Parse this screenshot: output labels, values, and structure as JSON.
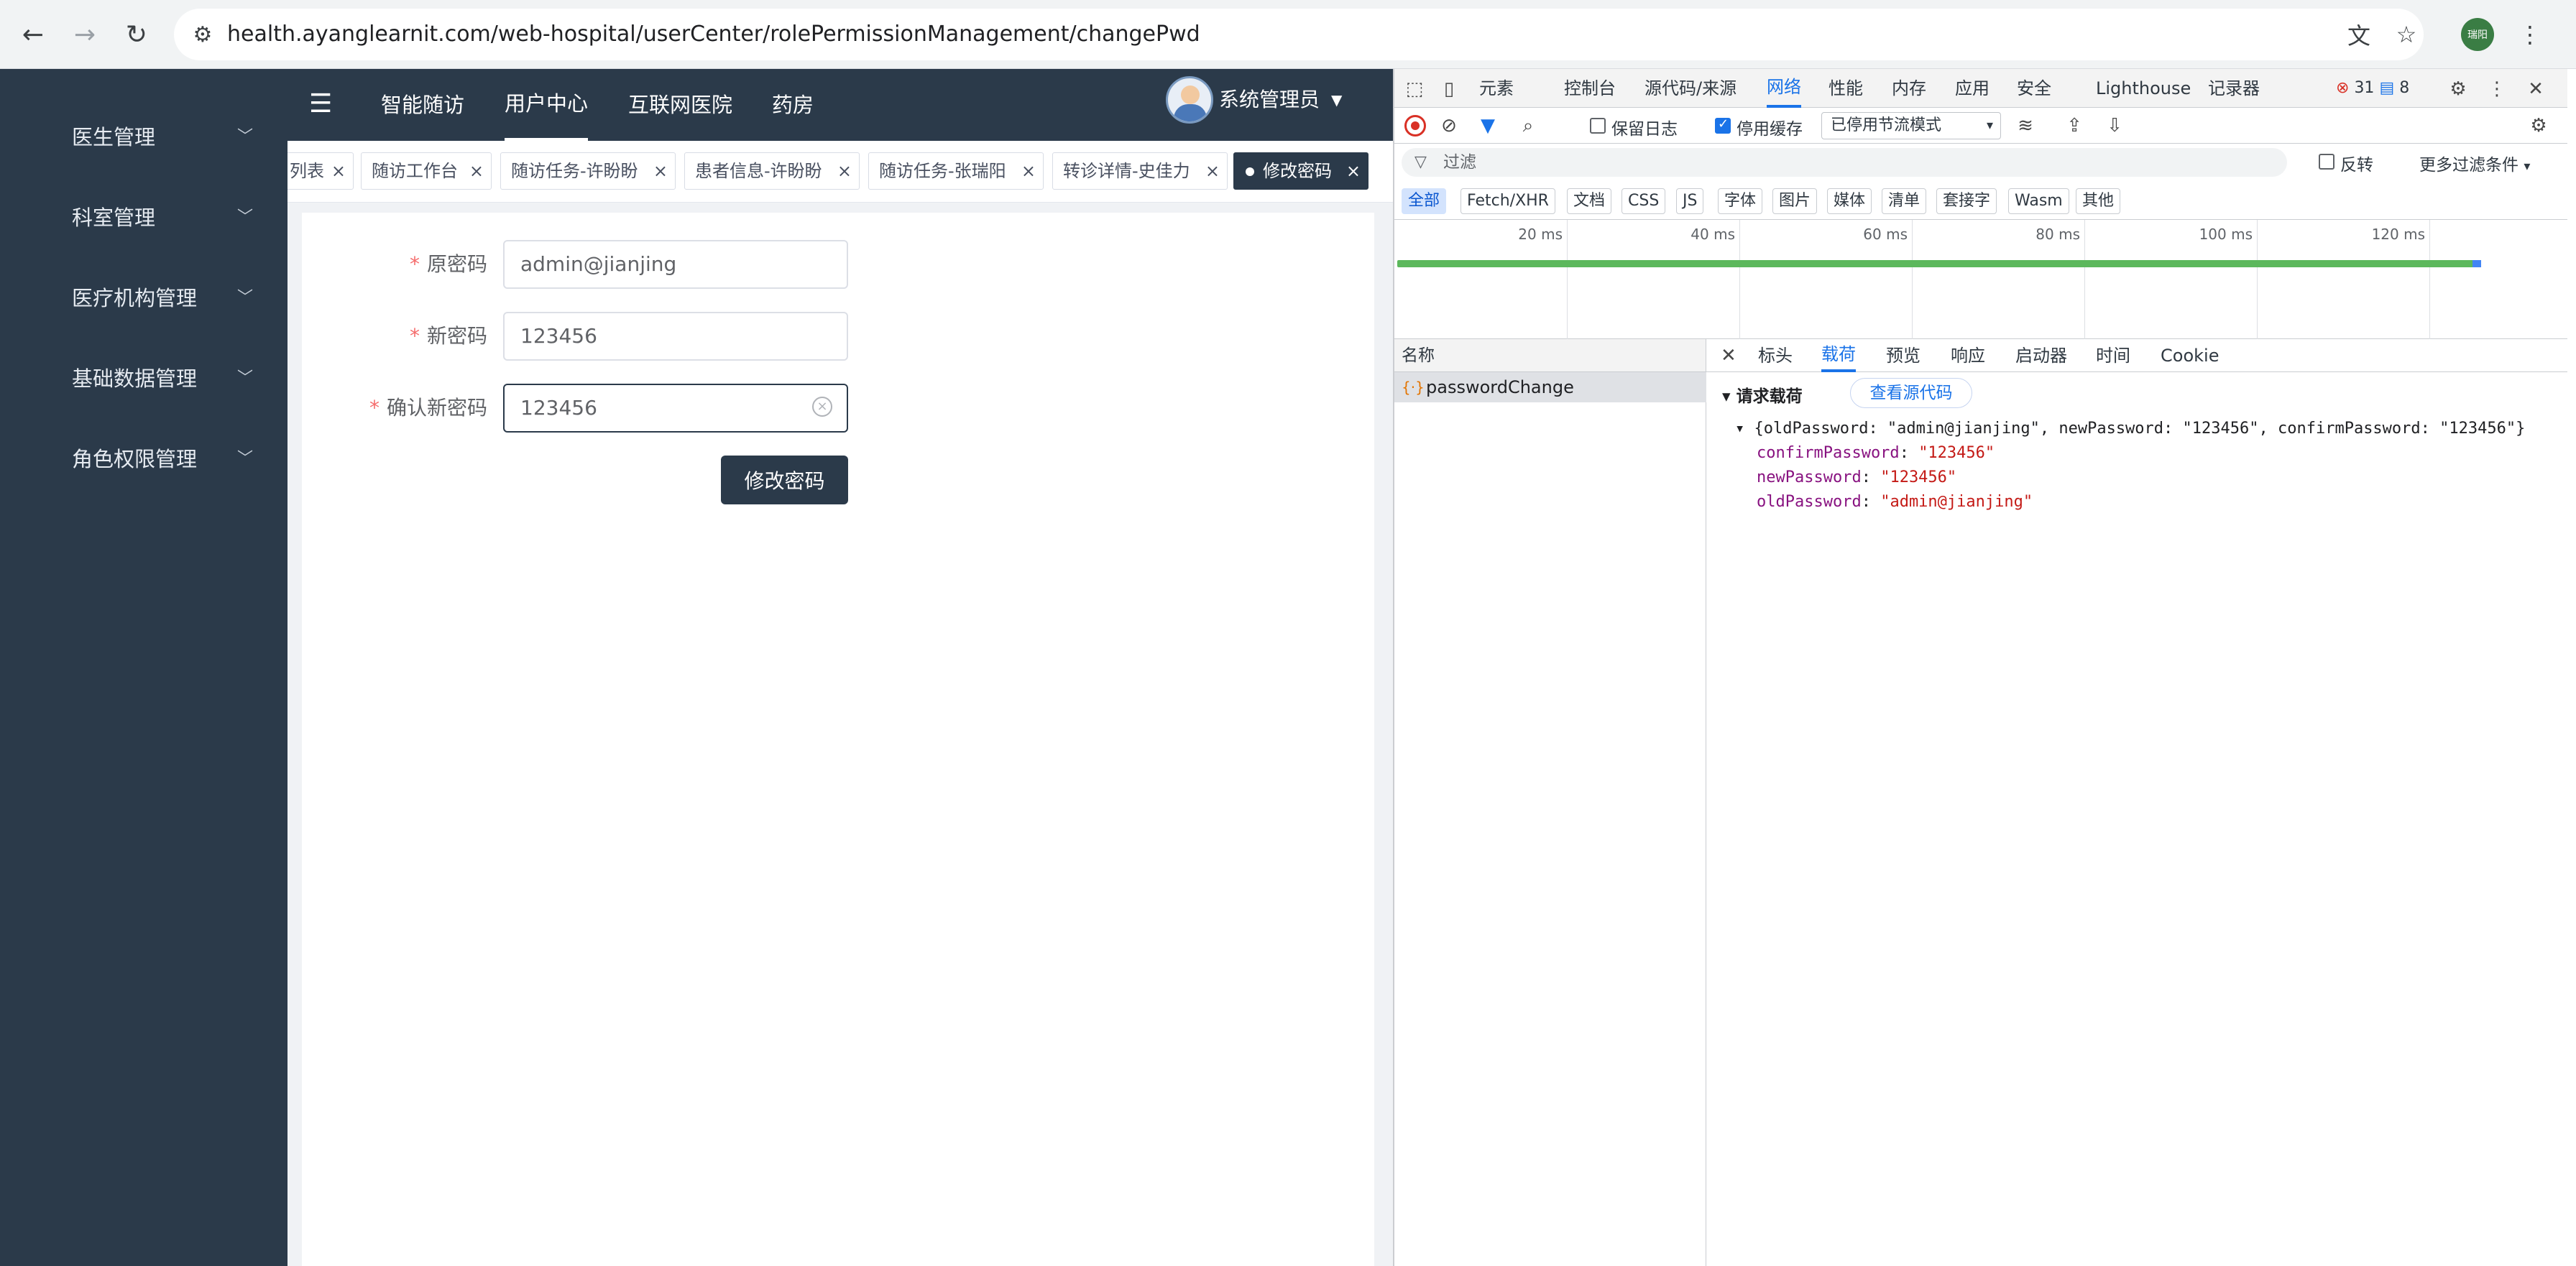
{
  "browser": {
    "url": "health.ayanglearnit.com/web-hospital/userCenter/rolePermissionManagement/changePwd",
    "profile_label": "瑞阳"
  },
  "sidebar": {
    "items": [
      {
        "label": "医生管理"
      },
      {
        "label": "科室管理"
      },
      {
        "label": "医疗机构管理"
      },
      {
        "label": "基础数据管理"
      },
      {
        "label": "角色权限管理"
      }
    ]
  },
  "header": {
    "nav": [
      {
        "label": "智能随访",
        "active": false
      },
      {
        "label": "用户中心",
        "active": true
      },
      {
        "label": "互联网医院",
        "active": false
      },
      {
        "label": "药房",
        "active": false
      }
    ],
    "username": "系统管理员"
  },
  "tags": [
    {
      "label": "列表"
    },
    {
      "label": "随访工作台"
    },
    {
      "label": "随访任务-许盼盼"
    },
    {
      "label": "患者信息-许盼盼"
    },
    {
      "label": "随访任务-张瑞阳"
    },
    {
      "label": "转诊详情-史佳力"
    },
    {
      "label": "修改密码",
      "active": true
    }
  ],
  "form": {
    "old_label": "原密码",
    "old_value": "admin@jianjing",
    "new_label": "新密码",
    "new_value": "123456",
    "confirm_label": "确认新密码",
    "confirm_value": "123456",
    "submit_label": "修改密码"
  },
  "devtools": {
    "tabs": [
      "元素",
      "控制台",
      "源代码/来源",
      "网络",
      "性能",
      "内存",
      "应用",
      "安全",
      "Lighthouse",
      "记录器"
    ],
    "active_tab": "网络",
    "errors": "31",
    "messages": "8",
    "preserve_log": "保留日志",
    "disable_cache": "停用缓存",
    "throttle": "已停用节流模式",
    "filter_placeholder": "过滤",
    "invert": "反转",
    "more_filters": "更多过滤条件",
    "type_filters": [
      "全部",
      "Fetch/XHR",
      "文档",
      "CSS",
      "JS",
      "字体",
      "图片",
      "媒体",
      "清单",
      "套接字",
      "Wasm",
      "其他"
    ],
    "timeline_ticks": [
      "20 ms",
      "40 ms",
      "60 ms",
      "80 ms",
      "100 ms",
      "120 ms"
    ],
    "name_header": "名称",
    "request_name": "passwordChange",
    "detail_tabs": [
      "标头",
      "载荷",
      "预览",
      "响应",
      "启动器",
      "时间",
      "Cookie"
    ],
    "active_detail_tab": "载荷",
    "payload_title": "请求载荷",
    "view_source": "查看源代码",
    "payload_summary": "{oldPassword: \"admin@jianjing\", newPassword: \"123456\", confirmPassword: \"123456\"}",
    "payload_fields": [
      {
        "key": "confirmPassword",
        "value": "\"123456\""
      },
      {
        "key": "newPassword",
        "value": "\"123456\""
      },
      {
        "key": "oldPassword",
        "value": "\"admin@jianjing\""
      }
    ]
  },
  "colors": {
    "sidebar_bg": "#2b3a4a",
    "devtools_accent": "#1a73e8",
    "required_star": "#f56c6c"
  }
}
